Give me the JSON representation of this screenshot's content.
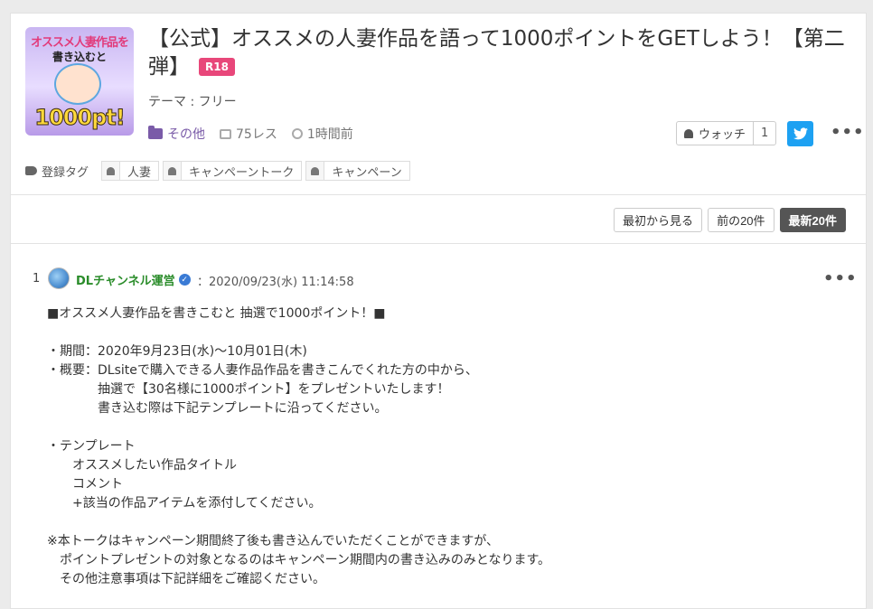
{
  "thread": {
    "thumbnail": {
      "line1": "オススメ人妻作品を",
      "line2": "書き込むと",
      "line3": "1000pt!"
    },
    "title": "【公式】オススメの人妻作品を語って1000ポイントをGETしよう！【第二弾】",
    "badge": "R18",
    "theme": "テーマ : フリー",
    "category": "その他",
    "replies": "75レス",
    "time": "1時間前",
    "watch_label": "ウォッチ",
    "watch_count": "1",
    "tags_label": "登録タグ",
    "tags": [
      "人妻",
      "キャンペーントーク",
      "キャンペーン"
    ]
  },
  "pager": {
    "first": "最初から見る",
    "prev": "前の20件",
    "latest": "最新20件"
  },
  "post": {
    "number": "1",
    "user": "DLチャンネル運営",
    "date": "：2020/09/23(水) 11:14:58",
    "lines": [
      "■オススメ人妻作品を書きこむと 抽選で1000ポイント！■",
      "",
      "・期間：2020年9月23日(水)～10月01日(木)",
      "・概要：DLsiteで購入できる人妻作品作品を書きこんでくれた方の中から、",
      "　　　　抽選で【30名様に1000ポイント】をプレゼントいたします！",
      "　　　　書き込む際は下記テンプレートに沿ってください。",
      "",
      "・テンプレート",
      "　　オススメしたい作品タイトル",
      "　　コメント",
      "　　+該当の作品アイテムを添付してください。",
      "",
      "※本トークはキャンペーン期間終了後も書き込んでいただくことができますが、",
      "　ポイントプレゼントの対象となるのはキャンペーン期間内の書き込みのみとなります。",
      "　その他注意事項は下記詳細をご確認ください。"
    ]
  },
  "icons": {
    "category": "folder-icon",
    "replies": "comment-icon",
    "time": "clock-icon",
    "watch": "bell-icon",
    "share": "twitter-icon",
    "more": "more-dots-icon",
    "tags": "tag-icon",
    "verified": "verified-check-icon"
  },
  "colors": {
    "badge": "#e8477a",
    "category": "#7a5ba8",
    "username": "#2a8c2a",
    "twitter": "#1da1f2",
    "latest_button": "#555555"
  }
}
